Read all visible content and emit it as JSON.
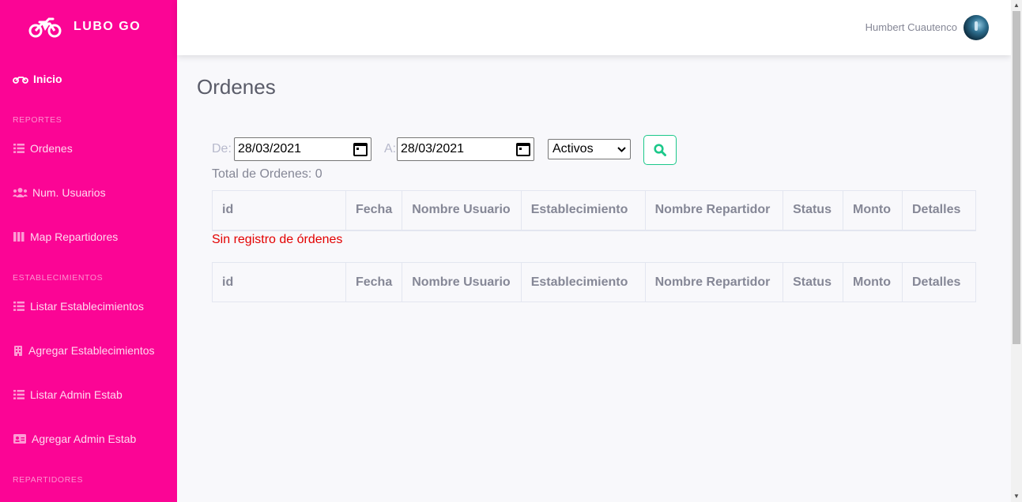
{
  "brand": {
    "name": "LUBO GO"
  },
  "sidebar": {
    "active_item": {
      "label": "Inicio",
      "icon": "motorcycle-icon"
    },
    "sections": [
      {
        "heading": "REPORTES",
        "items": [
          {
            "label": "Ordenes",
            "icon": "list-icon"
          },
          {
            "label": "Num. Usuarios",
            "icon": "users-icon"
          },
          {
            "label": "Map Repartidores",
            "icon": "map-icon"
          }
        ]
      },
      {
        "heading": "ESTABLECIMIENTOS",
        "items": [
          {
            "label": "Listar Establecimientos",
            "icon": "list-icon"
          },
          {
            "label": "Agregar Establecimientos",
            "icon": "building-icon"
          },
          {
            "label": "Listar Admin Estab",
            "icon": "list-icon"
          },
          {
            "label": "Agregar Admin Estab",
            "icon": "id-card-icon"
          }
        ]
      },
      {
        "heading": "REPARTIDORES",
        "items": []
      }
    ]
  },
  "topbar": {
    "user_name": "Humbert Cuautenco"
  },
  "main": {
    "title": "Ordenes",
    "filters": {
      "from_label": "De:",
      "from_value": "28/03/2021",
      "to_label": "A:",
      "to_value": "28/03/2021",
      "status_value": "Activos"
    },
    "total_label": "Total de Ordenes: 0",
    "columns": [
      "id",
      "Fecha",
      "Nombre Usuario",
      "Establecimiento",
      "Nombre Repartidor",
      "Status",
      "Monto",
      "Detalles"
    ],
    "empty_message": "Sin registro de órdenes"
  },
  "colors": {
    "sidebar": "#fb0595",
    "accent_success": "#1cc88a",
    "error_text": "#e30000"
  }
}
